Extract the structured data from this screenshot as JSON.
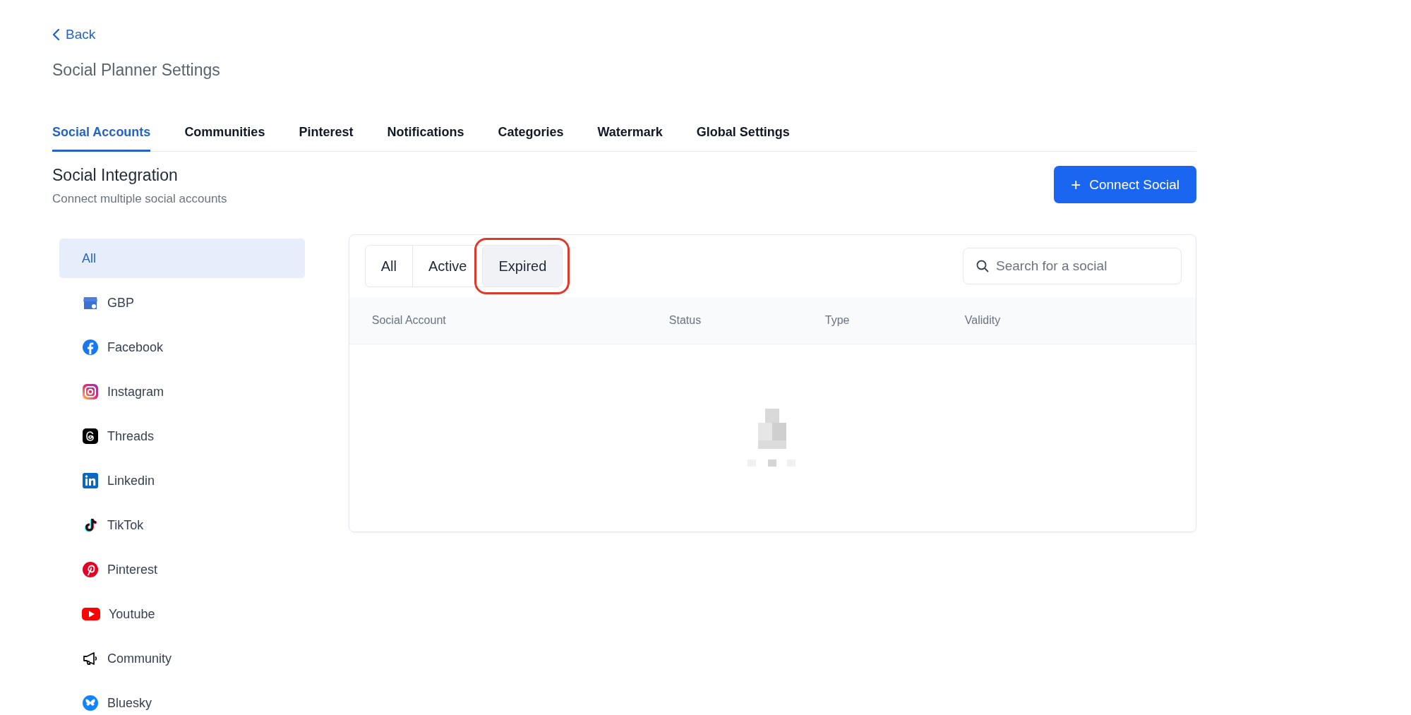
{
  "back_link": "Back",
  "page_title": "Social Planner Settings",
  "tabs": [
    {
      "label": "Social Accounts",
      "selected": true
    },
    {
      "label": "Communities",
      "selected": false
    },
    {
      "label": "Pinterest",
      "selected": false
    },
    {
      "label": "Notifications",
      "selected": false
    },
    {
      "label": "Categories",
      "selected": false
    },
    {
      "label": "Watermark",
      "selected": false
    },
    {
      "label": "Global Settings",
      "selected": false
    }
  ],
  "section": {
    "title": "Social Integration",
    "subtitle": "Connect multiple social accounts"
  },
  "connect_button": {
    "icon": "+",
    "label": "Connect Social"
  },
  "sidebar": {
    "items": [
      {
        "label": "All",
        "selected": true
      },
      {
        "label": "GBP",
        "selected": false
      },
      {
        "label": "Facebook",
        "selected": false
      },
      {
        "label": "Instagram",
        "selected": false
      },
      {
        "label": "Threads",
        "selected": false
      },
      {
        "label": "Linkedin",
        "selected": false
      },
      {
        "label": "TikTok",
        "selected": false
      },
      {
        "label": "Pinterest",
        "selected": false
      },
      {
        "label": "Youtube",
        "selected": false
      },
      {
        "label": "Community",
        "selected": false
      },
      {
        "label": "Bluesky",
        "selected": false
      }
    ]
  },
  "filters": [
    {
      "label": "All",
      "selected": false,
      "highlighted": false
    },
    {
      "label": "Active",
      "selected": false,
      "highlighted": false
    },
    {
      "label": "Expired",
      "selected": true,
      "highlighted": true
    }
  ],
  "search": {
    "placeholder": "Search for a social"
  },
  "table": {
    "columns": [
      "Social Account",
      "Status",
      "Type",
      "Validity"
    ]
  }
}
